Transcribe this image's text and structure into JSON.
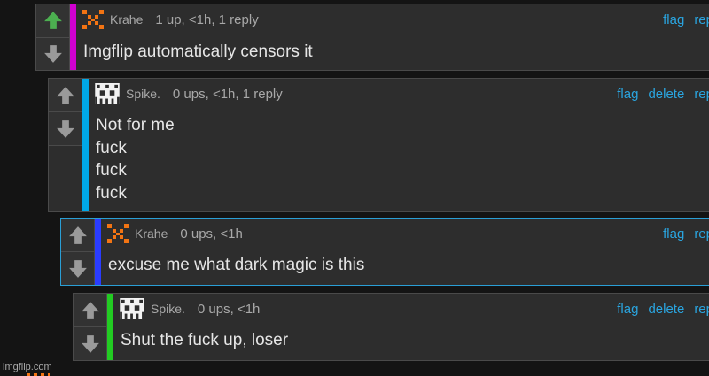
{
  "watermark": "imgflip.com",
  "icons": {
    "upvote": "up-arrow-icon",
    "downvote": "down-arrow-icon",
    "avatar_krahe": "orange-pixel-avatar",
    "avatar_spike": "pixel-skull-avatar"
  },
  "colors": {
    "upvoted": "#4caf50",
    "link": "#2aa5e0",
    "stripe1": "#d000d0",
    "stripe2": "#00a8e8",
    "stripe3": "#2a3cff",
    "stripe4": "#22cc22"
  },
  "comments": [
    {
      "user": "Krahe",
      "meta": "1 up, <1h, 1 reply",
      "actions": [
        "flag",
        "rep"
      ],
      "text": "Imgflip automatically censors it",
      "upvoted": true
    },
    {
      "user": "Spike.",
      "meta": "0 ups, <1h, 1 reply",
      "actions": [
        "flag",
        "delete",
        "rep"
      ],
      "text": "Not for me\nfuck\nfuck\nfuck",
      "upvoted": false
    },
    {
      "user": "Krahe",
      "meta": "0 ups, <1h",
      "actions": [
        "flag",
        "rep"
      ],
      "text": "excuse me what dark magic is this",
      "upvoted": false
    },
    {
      "user": "Spike.",
      "meta": "0 ups, <1h",
      "actions": [
        "flag",
        "delete",
        "rep"
      ],
      "text": "Shut the fuck up, loser",
      "upvoted": false
    }
  ]
}
